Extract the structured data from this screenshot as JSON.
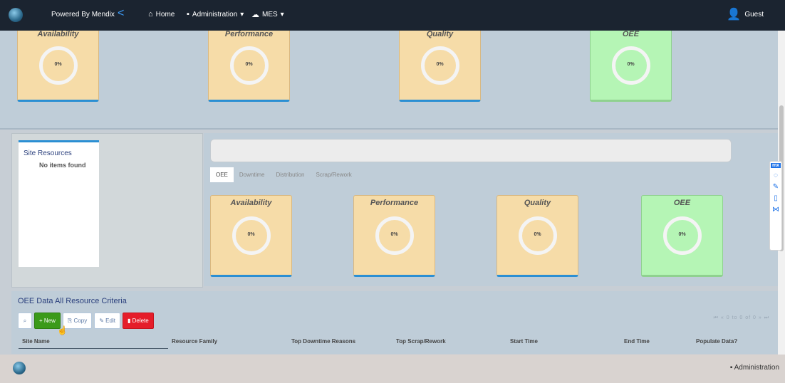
{
  "topbar": {
    "powered": "Powered By Mendix",
    "back_icon": "<",
    "home": "Home",
    "administration": "Administration",
    "mes": "MES",
    "user": "Guest"
  },
  "band1": {
    "cards": [
      {
        "title": "Availability",
        "value": "0%"
      },
      {
        "title": "Performance",
        "value": "0%"
      },
      {
        "title": "Quality",
        "value": "0%"
      },
      {
        "title": "OEE",
        "value": "0%"
      }
    ]
  },
  "site_resources": {
    "title": "Site Resources",
    "empty": "No items found"
  },
  "tabs": [
    "OEE",
    "Downtime",
    "Distribution",
    "Scrap/Rework"
  ],
  "metrics": [
    {
      "title": "Availability",
      "value": "0%"
    },
    {
      "title": "Performance",
      "value": "0%"
    },
    {
      "title": "Quality",
      "value": "0%"
    },
    {
      "title": "OEE",
      "value": "0%"
    }
  ],
  "grid": {
    "title": "OEE Data All Resource Criteria",
    "buttons": {
      "new": "New",
      "copy": "Copy",
      "edit": "Edit",
      "delete": "Delete"
    },
    "pager": "0 to 0 of 0",
    "columns": [
      "Site Name",
      "Resource Family",
      "Top Downtime Reasons",
      "Top Scrap/Rework",
      "Start Time",
      "End Time",
      "Populate Data?"
    ]
  },
  "footer": {
    "administration": "Administration"
  },
  "mx_tool": {
    "label": "mx"
  }
}
